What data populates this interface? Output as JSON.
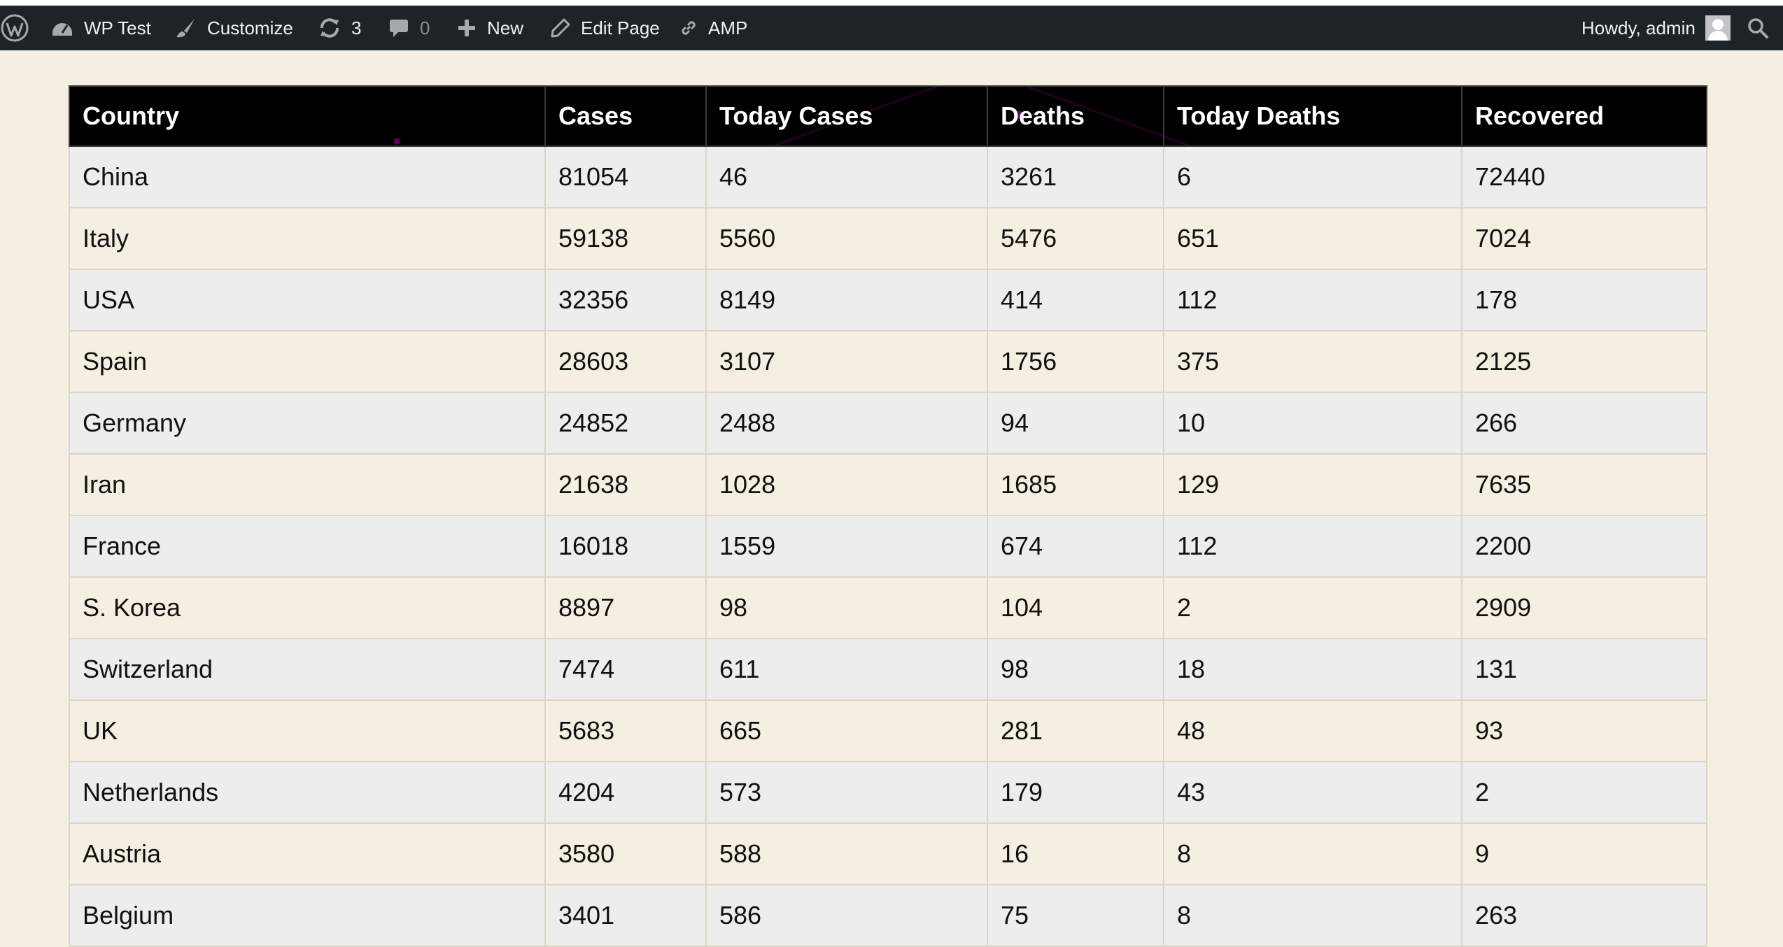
{
  "admin_bar": {
    "site_name": "WP Test",
    "customize": "Customize",
    "updates_count": "3",
    "comments_count": "0",
    "new": "New",
    "edit_page": "Edit Page",
    "amp": "AMP",
    "greeting": "Howdy, admin"
  },
  "table": {
    "headers": [
      "Country",
      "Cases",
      "Today Cases",
      "Deaths",
      "Today Deaths",
      "Recovered"
    ],
    "rows": [
      [
        "China",
        "81054",
        "46",
        "3261",
        "6",
        "72440"
      ],
      [
        "Italy",
        "59138",
        "5560",
        "5476",
        "651",
        "7024"
      ],
      [
        "USA",
        "32356",
        "8149",
        "414",
        "112",
        "178"
      ],
      [
        "Spain",
        "28603",
        "3107",
        "1756",
        "375",
        "2125"
      ],
      [
        "Germany",
        "24852",
        "2488",
        "94",
        "10",
        "266"
      ],
      [
        "Iran",
        "21638",
        "1028",
        "1685",
        "129",
        "7635"
      ],
      [
        "France",
        "16018",
        "1559",
        "674",
        "112",
        "2200"
      ],
      [
        "S. Korea",
        "8897",
        "98",
        "104",
        "2",
        "2909"
      ],
      [
        "Switzerland",
        "7474",
        "611",
        "98",
        "18",
        "131"
      ],
      [
        "UK",
        "5683",
        "665",
        "281",
        "48",
        "93"
      ],
      [
        "Netherlands",
        "4204",
        "573",
        "179",
        "43",
        "2"
      ],
      [
        "Austria",
        "3580",
        "588",
        "16",
        "8",
        "9"
      ],
      [
        "Belgium",
        "3401",
        "586",
        "75",
        "8",
        "263"
      ]
    ]
  },
  "icons": {
    "wordpress": "wordpress-logo-icon",
    "site": "dashboard-icon",
    "customize": "paintbrush-icon",
    "updates": "refresh-icon",
    "comments": "comment-bubble-icon",
    "new": "plus-icon",
    "edit": "pencil-icon",
    "amp": "link-icon",
    "search": "search-icon"
  },
  "colors": {
    "admin_bar_bg": "#1d2327",
    "page_bg": "#f4efe1",
    "header_bg": "#000000",
    "row_alt": "#ededed"
  }
}
